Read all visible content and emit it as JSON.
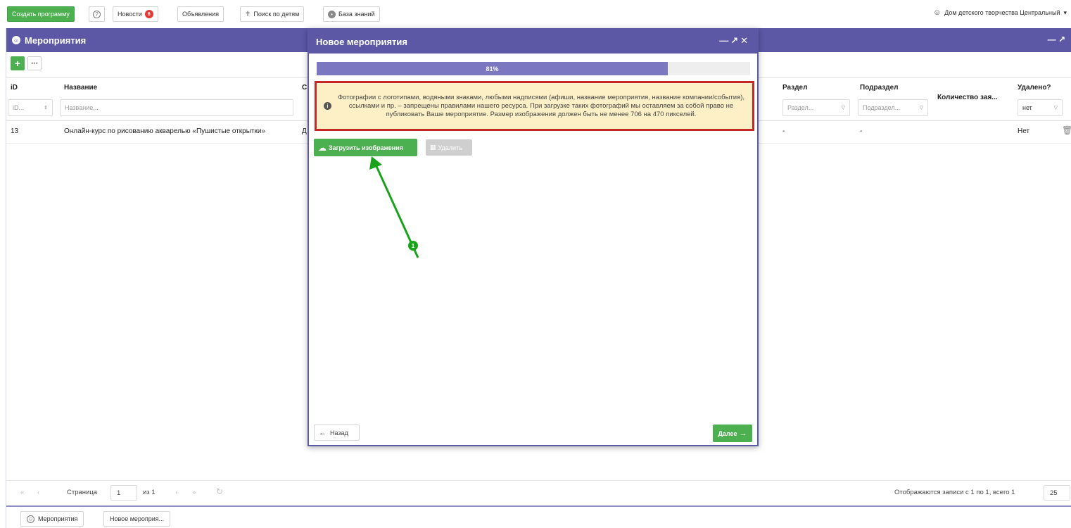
{
  "topbar": {
    "create_program": "Создать программу",
    "help_icon": "question-icon",
    "news": "Новости",
    "news_count": "6",
    "announcements": "Объявления",
    "child_search": "Поиск по детям",
    "knowledge_base": "База знаний",
    "organization": "Дом детского творчества Центральный"
  },
  "panel": {
    "title": "Мероприятия",
    "columns": {
      "id": "iD",
      "name": "Название",
      "section": "Раздел",
      "subsection": "Подраздел",
      "applications": "Количество зая...",
      "deleted": "Удалено?"
    },
    "filters": {
      "id_placeholder": "iD...",
      "name_placeholder": "Название...",
      "section_placeholder": "Раздел...",
      "subsection_placeholder": "Подраздел...",
      "deleted_value": "нет"
    },
    "rows": [
      {
        "id": "13",
        "name": "Онлайн-курс по рисованию акварелью «Пушистые открытки»",
        "partial": "Д",
        "section": "-",
        "subsection": "-",
        "deleted": "Нет"
      }
    ]
  },
  "pager": {
    "page_label": "Страница",
    "page_value": "1",
    "of_label": "из 1",
    "records_text": "Отображаются записи с 1 по 1, всего 1",
    "page_size": "25"
  },
  "taskbar": {
    "items": [
      "Мероприятия",
      "Новое мероприя..."
    ]
  },
  "modal": {
    "title": "Новое мероприятия",
    "progress_text": "81%",
    "progress_value": 81,
    "warning": "Фотографии с логотипами, водяными знаками, любыми надписями (афиши, название мероприятия, название компании/события), ссылками и пр. – запрещены правилами нашего ресурса. При загрузке таких фотографий мы оставляем за собой право не публиковать Ваше мероприятие. Размер изображения должен быть не менее 706 на 470 пикселей.",
    "upload_label": "Загрузить изображения",
    "delete_label": "Удалить",
    "back_label": "Назад",
    "next_label": "Далее"
  },
  "annotation": {
    "marker": "1",
    "color": "#1aa31a"
  },
  "colors": {
    "header": "#5c58a6",
    "green": "#4caf50",
    "warning_bg": "#fdf0c7",
    "warning_border": "#c62828"
  }
}
